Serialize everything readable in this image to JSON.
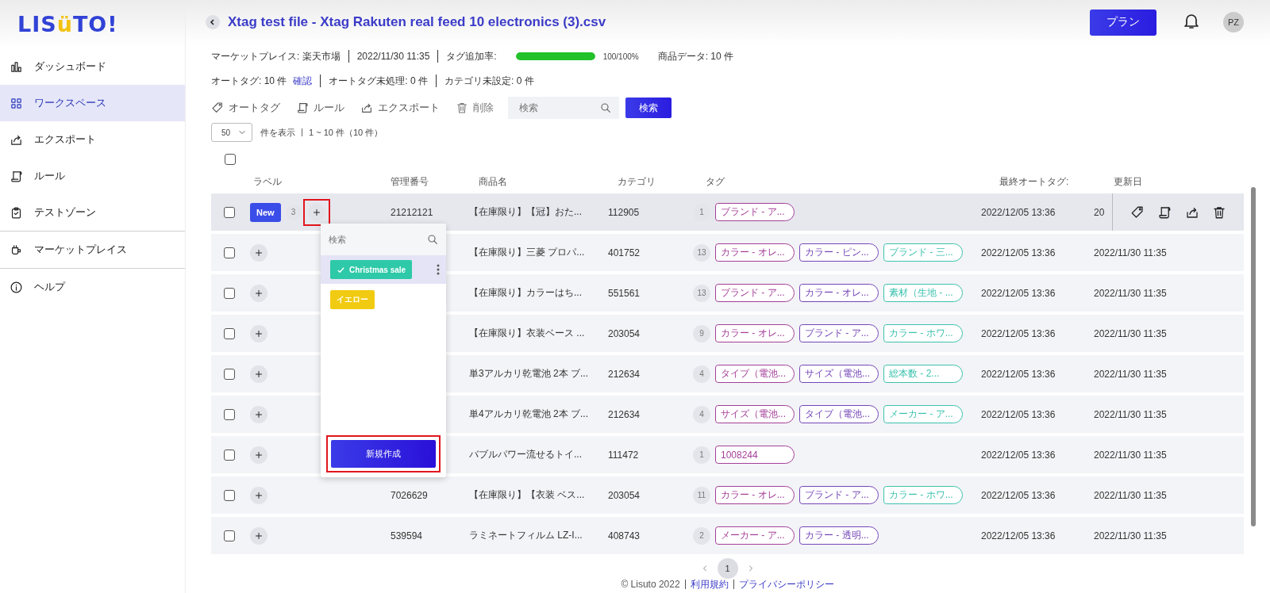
{
  "logo": {
    "parts": [
      {
        "text": "LIS",
        "accent": false
      },
      {
        "text": "ü",
        "accent": true
      },
      {
        "text": "TO!",
        "accent": false
      }
    ]
  },
  "sidebar": {
    "items": [
      {
        "label": "ダッシュボード",
        "selected": false,
        "divider_after": false
      },
      {
        "label": "ワークスペース",
        "selected": true,
        "divider_after": false
      },
      {
        "label": "エクスポート",
        "selected": false,
        "divider_after": false
      },
      {
        "label": "ルール",
        "selected": false,
        "divider_after": false
      },
      {
        "label": "テストゾーン",
        "selected": false,
        "divider_after": true
      },
      {
        "label": "マーケットプレイス",
        "selected": false,
        "divider_after": true
      },
      {
        "label": "ヘルプ",
        "selected": false,
        "divider_after": false
      }
    ]
  },
  "header": {
    "title": "Xtag test file - Xtag Rakuten real feed 10 electronics (3).csv",
    "plan_button": "プラン",
    "avatar": "PZ"
  },
  "info": {
    "marketplace": "マーケットプレイス: 楽天市場",
    "date": "2022/11/30 11:35",
    "tag_rate_label": "タグ追加率:",
    "tag_rate": {
      "level": 1.0
    },
    "tag_rate_reading": "100/100%",
    "product_data": "商品データ: 10 件",
    "autotag": "オートタグ: 10 件",
    "confirm_link": "確認",
    "autotag_pending": "オートタグ未処理: 0 件",
    "category_unset": "カテゴリ未設定: 0 件"
  },
  "toolbar": {
    "actions": [
      {
        "label": "オートタグ",
        "disabled": false
      },
      {
        "label": "ルール",
        "disabled": false
      },
      {
        "label": "エクスポート",
        "disabled": false
      },
      {
        "label": "削除",
        "disabled": true
      }
    ],
    "search": {
      "placeholder": "検索"
    },
    "search_button": "検索"
  },
  "pager": {
    "page_size": "50",
    "show_label": "件を表示",
    "range": "1 ~ 10 件（10 件）"
  },
  "table": {
    "select_all": {
      "checked": false
    },
    "columns": [
      "ラベル",
      "管理番号",
      "商品名",
      "カテゴリ",
      "タグ",
      "最終オートタグ:",
      "更新日"
    ],
    "rows": [
      {
        "checked": false,
        "hovered": true,
        "label_badge": "New",
        "label_count": "3",
        "add_highlighted": true,
        "code": "21212121",
        "name": "【在庫限り】【冠】おた...",
        "category": "112905",
        "tag_count": "1",
        "tags": [
          {
            "text": "ブランド - ア...",
            "color": "#a43f98"
          }
        ],
        "last_autotag": "2022/12/05 13:36",
        "updated": "20"
      },
      {
        "checked": false,
        "hovered": false,
        "add_highlighted": false,
        "name": "【在庫限り】三菱 プロパ...",
        "category": "401752",
        "tag_count": "13",
        "tags": [
          {
            "text": "カラー - オレ...",
            "color": "#a43f98"
          },
          {
            "text": "カラー - ピン...",
            "color": "#7446b8"
          },
          {
            "text": "ブランド - 三...",
            "color": "#3cc2ad"
          }
        ],
        "last_autotag": "2022/12/05 13:36",
        "updated": "2022/11/30 11:35"
      },
      {
        "checked": false,
        "hovered": false,
        "add_highlighted": false,
        "name": "【在庫限り】カラーはち...",
        "category": "551561",
        "tag_count": "13",
        "tags": [
          {
            "text": "ブランド - ア...",
            "color": "#a43f98"
          },
          {
            "text": "カラー - オレ...",
            "color": "#7446b8"
          },
          {
            "text": "素材（生地 - ...",
            "color": "#3cc2ad"
          }
        ],
        "last_autotag": "2022/12/05 13:36",
        "updated": "2022/11/30 11:35"
      },
      {
        "checked": false,
        "hovered": false,
        "add_highlighted": false,
        "name": "【在庫限り】衣装ベース ...",
        "category": "203054",
        "tag_count": "9",
        "tags": [
          {
            "text": "カラー - オレ...",
            "color": "#a43f98"
          },
          {
            "text": "ブランド - ア...",
            "color": "#7446b8"
          },
          {
            "text": "カラー - ホワ...",
            "color": "#3cc2ad"
          }
        ],
        "last_autotag": "2022/12/05 13:36",
        "updated": "2022/11/30 11:35"
      },
      {
        "checked": false,
        "hovered": false,
        "add_highlighted": false,
        "name": "単3アルカリ乾電池 2本 ブ...",
        "category": "212634",
        "tag_count": "4",
        "tags": [
          {
            "text": "タイプ（電池...",
            "color": "#a43f98"
          },
          {
            "text": "サイズ（電池...",
            "color": "#7446b8"
          },
          {
            "text": "総本数 - 2...",
            "color": "#3cc2ad"
          }
        ],
        "last_autotag": "2022/12/05 13:36",
        "updated": "2022/11/30 11:35"
      },
      {
        "checked": false,
        "hovered": false,
        "add_highlighted": false,
        "name": "単4アルカリ乾電池 2本 ブ...",
        "category": "212634",
        "tag_count": "4",
        "tags": [
          {
            "text": "サイズ（電池...",
            "color": "#a43f98"
          },
          {
            "text": "タイプ（電池...",
            "color": "#7446b8"
          },
          {
            "text": "メーカー - ア...",
            "color": "#3cc2ad"
          }
        ],
        "last_autotag": "2022/12/05 13:36",
        "updated": "2022/11/30 11:35"
      },
      {
        "checked": false,
        "hovered": false,
        "add_highlighted": false,
        "name": "バブルパワー流せるトイ...",
        "category": "111472",
        "tag_count": "1",
        "tags": [
          {
            "text": "1008244",
            "color": "#a43f98"
          }
        ],
        "last_autotag": "2022/12/05 13:36",
        "updated": "2022/11/30 11:35"
      },
      {
        "checked": false,
        "hovered": false,
        "add_highlighted": false,
        "code": "7026629",
        "name": "【在庫限り】【衣装 ベス...",
        "category": "203054",
        "tag_count": "11",
        "tags": [
          {
            "text": "カラー - オレ...",
            "color": "#a43f98"
          },
          {
            "text": "ブランド - ア...",
            "color": "#7446b8"
          },
          {
            "text": "カラー - ホワ...",
            "color": "#3cc2ad"
          }
        ],
        "last_autotag": "2022/12/05 13:36",
        "updated": "2022/11/30 11:35"
      },
      {
        "checked": false,
        "hovered": false,
        "add_highlighted": false,
        "code": "539594",
        "name": "ラミネートフィルム LZ-I...",
        "category": "408743",
        "tag_count": "2",
        "tags": [
          {
            "text": "メーカー - ア...",
            "color": "#a43f98"
          },
          {
            "text": "カラー - 透明...",
            "color": "#7446b8"
          }
        ],
        "last_autotag": "2022/12/05 13:36",
        "updated": "2022/11/30 11:35"
      }
    ]
  },
  "label_menu": {
    "search": {
      "placeholder": "検索"
    },
    "labels": [
      {
        "text": "Christmas sale",
        "color": "#2ec9a8",
        "checked": true,
        "selected": true
      },
      {
        "text": "イエロー",
        "color": "#f1cb12",
        "checked": false,
        "selected": false
      }
    ],
    "create_button": "新規作成",
    "create_highlighted": true
  },
  "pagination": {
    "pages": [
      {
        "label": "1",
        "selected": true
      }
    ]
  },
  "footer": {
    "copyright": "© Lisuto 2022",
    "links": [
      "利用規約",
      "プライバシーポリシー"
    ]
  }
}
